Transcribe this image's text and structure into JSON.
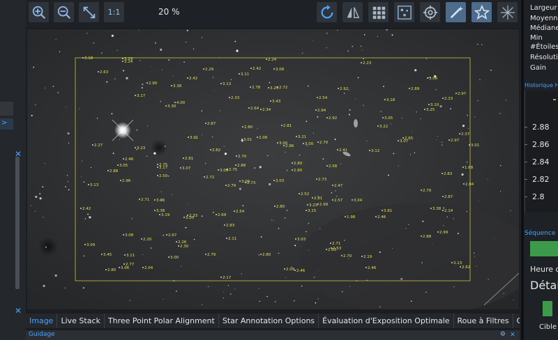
{
  "toolbar": {
    "zoom_in_icon": "zoom-in-icon",
    "zoom_out_icon": "zoom-out-icon",
    "fit_icon": "fit-screen-icon",
    "one_to_one_label": "1:1",
    "zoom_level": "20 %"
  },
  "tabs": [
    {
      "label": "Image",
      "active": true
    },
    {
      "label": "Live Stack"
    },
    {
      "label": "Three Point Polar Alignment"
    },
    {
      "label": "Star Annotation Options"
    },
    {
      "label": "Évaluation d'Exposition Optimale"
    },
    {
      "label": "Roue à Filtres"
    },
    {
      "label": "Orbitals"
    }
  ],
  "guide_bar": {
    "title": "Guidage"
  },
  "stats": {
    "labels": [
      "Largeur",
      "Moyenne",
      "Médiane",
      "Min",
      "#Étoiles",
      "Résolution",
      "Gain"
    ]
  },
  "history": {
    "title": "Historique HFR",
    "y_ticks": [
      "2.88",
      "2.86",
      "2.84",
      "2.82",
      "2.8"
    ]
  },
  "sequence": {
    "title": "Séquence",
    "heure_label": "Heure de",
    "detail_label": "Détail",
    "cible_label": "Cible",
    "accent": "#3d9a4a"
  },
  "colors": {
    "accent": "#4aa3ff",
    "annotation": "#e6e052"
  },
  "annotations": [
    {
      "t": "3.18",
      "x": 82,
      "y": 43
    },
    {
      "t": "3.29",
      "x": 139,
      "y": 44
    },
    {
      "t": "3.24",
      "x": 139,
      "y": 48
    },
    {
      "t": "2.24",
      "x": 345,
      "y": 45
    },
    {
      "t": "2.23",
      "x": 481,
      "y": 50
    },
    {
      "t": "2.63",
      "x": 104,
      "y": 63
    },
    {
      "t": "2.29",
      "x": 255,
      "y": 59
    },
    {
      "t": "2.42",
      "x": 323,
      "y": 58
    },
    {
      "t": "3.08",
      "x": 356,
      "y": 59
    },
    {
      "t": "3.11",
      "x": 306,
      "y": 66
    },
    {
      "t": "2.42",
      "x": 232,
      "y": 72
    },
    {
      "t": "3.06",
      "x": 576,
      "y": 72
    },
    {
      "t": "2.90",
      "x": 174,
      "y": 79
    },
    {
      "t": "3.38",
      "x": 209,
      "y": 83
    },
    {
      "t": "3.13",
      "x": 280,
      "y": 80
    },
    {
      "t": "2.78",
      "x": 322,
      "y": 85
    },
    {
      "t": "3.25",
      "x": 348,
      "y": 86
    },
    {
      "t": "2.72",
      "x": 361,
      "y": 85
    },
    {
      "t": "2.92",
      "x": 448,
      "y": 87
    },
    {
      "t": "2.89",
      "x": 550,
      "y": 87
    },
    {
      "t": "2.97",
      "x": 617,
      "y": 94
    },
    {
      "t": "3.17",
      "x": 157,
      "y": 97
    },
    {
      "t": "2.33",
      "x": 292,
      "y": 100
    },
    {
      "t": "3.43",
      "x": 351,
      "y": 105
    },
    {
      "t": "2.54",
      "x": 418,
      "y": 100
    },
    {
      "t": "3.18",
      "x": 515,
      "y": 103
    },
    {
      "t": "2.23",
      "x": 598,
      "y": 101
    },
    {
      "t": "3.10",
      "x": 578,
      "y": 110
    },
    {
      "t": "4.00",
      "x": 214,
      "y": 107
    },
    {
      "t": "3.30",
      "x": 201,
      "y": 112
    },
    {
      "t": "2.64",
      "x": 320,
      "y": 115
    },
    {
      "t": "2.34",
      "x": 337,
      "y": 117
    },
    {
      "t": "2.94",
      "x": 416,
      "y": 118
    },
    {
      "t": "3.25",
      "x": 572,
      "y": 117
    },
    {
      "t": "2.92",
      "x": 432,
      "y": 129
    },
    {
      "t": "3.05",
      "x": 512,
      "y": 129
    },
    {
      "t": "2.87",
      "x": 258,
      "y": 137
    },
    {
      "t": "2.80",
      "x": 311,
      "y": 142
    },
    {
      "t": "2.81",
      "x": 367,
      "y": 140
    },
    {
      "t": "3.22",
      "x": 505,
      "y": 141
    },
    {
      "t": "2.37",
      "x": 622,
      "y": 152
    },
    {
      "t": "3.01",
      "x": 233,
      "y": 157
    },
    {
      "t": "2.08",
      "x": 332,
      "y": 157
    },
    {
      "t": "3.21",
      "x": 388,
      "y": 156
    },
    {
      "t": "3.01",
      "x": 310,
      "y": 160
    },
    {
      "t": "2.65",
      "x": 541,
      "y": 158
    },
    {
      "t": "3.07",
      "x": 534,
      "y": 162
    },
    {
      "t": "2.97",
      "x": 607,
      "y": 161
    },
    {
      "t": "3.01",
      "x": 636,
      "y": 168
    },
    {
      "t": "2.27",
      "x": 96,
      "y": 168
    },
    {
      "t": "3.00",
      "x": 361,
      "y": 165
    },
    {
      "t": "2.96",
      "x": 370,
      "y": 169
    },
    {
      "t": "3.00",
      "x": 398,
      "y": 166
    },
    {
      "t": "2.70",
      "x": 419,
      "y": 164
    },
    {
      "t": "3.23",
      "x": 157,
      "y": 172
    },
    {
      "t": "2.82",
      "x": 265,
      "y": 175
    },
    {
      "t": "2.41",
      "x": 447,
      "y": 175
    },
    {
      "t": "3.12",
      "x": 493,
      "y": 176
    },
    {
      "t": "2.46",
      "x": 140,
      "y": 188
    },
    {
      "t": "2.81",
      "x": 226,
      "y": 187
    },
    {
      "t": "2.70",
      "x": 302,
      "y": 184
    },
    {
      "t": "3.05",
      "x": 132,
      "y": 197
    },
    {
      "t": "2.75",
      "x": 189,
      "y": 196
    },
    {
      "t": "3.17",
      "x": 189,
      "y": 200
    },
    {
      "t": "3.07",
      "x": 222,
      "y": 201
    },
    {
      "t": "2.88",
      "x": 301,
      "y": 197
    },
    {
      "t": "3.08",
      "x": 276,
      "y": 204
    },
    {
      "t": "2.75",
      "x": 289,
      "y": 203
    },
    {
      "t": "2.80",
      "x": 382,
      "y": 194
    },
    {
      "t": "2.58",
      "x": 432,
      "y": 198
    },
    {
      "t": "2.60",
      "x": 382,
      "y": 204
    },
    {
      "t": "2.88",
      "x": 118,
      "y": 205
    },
    {
      "t": "1.68",
      "x": 627,
      "y": 200
    },
    {
      "t": "2.50",
      "x": 189,
      "y": 212
    },
    {
      "t": "2.72",
      "x": 256,
      "y": 214
    },
    {
      "t": "2.83",
      "x": 597,
      "y": 209
    },
    {
      "t": "2.96",
      "x": 136,
      "y": 219
    },
    {
      "t": "3.09",
      "x": 307,
      "y": 220
    },
    {
      "t": "2.73",
      "x": 315,
      "y": 222
    },
    {
      "t": "3.03",
      "x": 356,
      "y": 219
    },
    {
      "t": "2.73",
      "x": 417,
      "y": 217
    },
    {
      "t": "2.47",
      "x": 440,
      "y": 226
    },
    {
      "t": "3.13",
      "x": 90,
      "y": 225
    },
    {
      "t": "2.79",
      "x": 287,
      "y": 226
    },
    {
      "t": "2.84",
      "x": 628,
      "y": 224
    },
    {
      "t": "2.79",
      "x": 567,
      "y": 233
    },
    {
      "t": "2.52",
      "x": 392,
      "y": 238
    },
    {
      "t": "2.81",
      "x": 411,
      "y": 244
    },
    {
      "t": "2.87",
      "x": 598,
      "y": 242
    },
    {
      "t": "2.71",
      "x": 163,
      "y": 246
    },
    {
      "t": "3.06",
      "x": 185,
      "y": 247
    },
    {
      "t": "2.57",
      "x": 440,
      "y": 247
    },
    {
      "t": "3.04",
      "x": 468,
      "y": 247
    },
    {
      "t": "3.23",
      "x": 404,
      "y": 254
    },
    {
      "t": "2.99",
      "x": 419,
      "y": 253
    },
    {
      "t": "2.80",
      "x": 357,
      "y": 256
    },
    {
      "t": "2.42",
      "x": 79,
      "y": 259
    },
    {
      "t": "3.38",
      "x": 185,
      "y": 262
    },
    {
      "t": "3.19",
      "x": 192,
      "y": 268
    },
    {
      "t": "2.54",
      "x": 299,
      "y": 263
    },
    {
      "t": "3.15",
      "x": 402,
      "y": 262
    },
    {
      "t": "3.81",
      "x": 511,
      "y": 262
    },
    {
      "t": "3.38",
      "x": 581,
      "y": 259
    },
    {
      "t": "2.14",
      "x": 598,
      "y": 262
    },
    {
      "t": "2.33",
      "x": 232,
      "y": 269
    },
    {
      "t": "3.00",
      "x": 227,
      "y": 272
    },
    {
      "t": "2.69",
      "x": 273,
      "y": 268
    },
    {
      "t": "1.98",
      "x": 458,
      "y": 271
    },
    {
      "t": "2.46",
      "x": 502,
      "y": 271
    },
    {
      "t": "2.83",
      "x": 285,
      "y": 283
    },
    {
      "t": "2.99",
      "x": 591,
      "y": 293
    },
    {
      "t": "3.08",
      "x": 140,
      "y": 297
    },
    {
      "t": "2.67",
      "x": 202,
      "y": 297
    },
    {
      "t": "2.88",
      "x": 567,
      "y": 299
    },
    {
      "t": "2.20",
      "x": 166,
      "y": 303
    },
    {
      "t": "2.11",
      "x": 288,
      "y": 302
    },
    {
      "t": "3.03",
      "x": 387,
      "y": 303
    },
    {
      "t": "2.26",
      "x": 216,
      "y": 307
    },
    {
      "t": "2.30",
      "x": 219,
      "y": 313
    },
    {
      "t": "2.71",
      "x": 437,
      "y": 309
    },
    {
      "t": "3.09",
      "x": 85,
      "y": 311
    },
    {
      "t": "2.53",
      "x": 438,
      "y": 316
    },
    {
      "t": "2.63",
      "x": 431,
      "y": 318
    },
    {
      "t": "3.45",
      "x": 109,
      "y": 325
    },
    {
      "t": "3.11",
      "x": 142,
      "y": 326
    },
    {
      "t": "2.79",
      "x": 258,
      "y": 325
    },
    {
      "t": "2.80",
      "x": 337,
      "y": 325
    },
    {
      "t": "2.70",
      "x": 453,
      "y": 327
    },
    {
      "t": "2.19",
      "x": 482,
      "y": 328
    },
    {
      "t": "3.00",
      "x": 205,
      "y": 329
    },
    {
      "t": "3.13",
      "x": 611,
      "y": 337
    },
    {
      "t": "2.62",
      "x": 623,
      "y": 343
    },
    {
      "t": "2.77",
      "x": 141,
      "y": 339
    },
    {
      "t": "3.06",
      "x": 134,
      "y": 344
    },
    {
      "t": "2.04",
      "x": 168,
      "y": 344
    },
    {
      "t": "2.46",
      "x": 488,
      "y": 344
    },
    {
      "t": "2.09",
      "x": 371,
      "y": 346
    },
    {
      "t": "2.46",
      "x": 386,
      "y": 348
    },
    {
      "t": "2.80",
      "x": 115,
      "y": 347
    },
    {
      "t": "2.17",
      "x": 280,
      "y": 358
    }
  ]
}
